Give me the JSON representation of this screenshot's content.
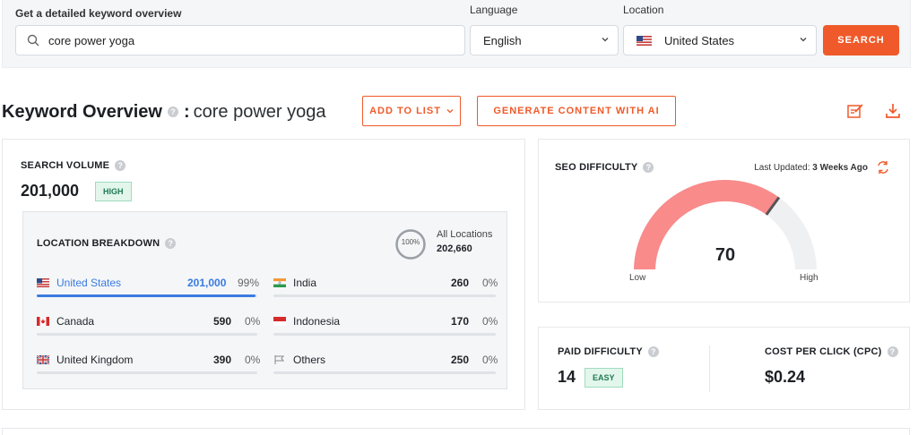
{
  "search": {
    "label": "Get a detailed keyword overview",
    "value": "core power yoga",
    "language_label": "Language",
    "language_value": "English",
    "location_label": "Location",
    "location_value": "United States",
    "button": "SEARCH"
  },
  "header": {
    "title": "Keyword Overview",
    "separator": ":",
    "keyword": "core power yoga",
    "add_to_list": "ADD TO LIST",
    "generate": "GENERATE CONTENT WITH AI"
  },
  "search_volume": {
    "title": "SEARCH VOLUME",
    "value": "201,000",
    "badge": "HIGH"
  },
  "location_breakdown": {
    "title": "LOCATION BREAKDOWN",
    "ring": "100%",
    "ring_value": 1.0,
    "all_label": "All Locations",
    "all_value": "202,660",
    "left": [
      {
        "name": "United States",
        "value": "201,000",
        "pct": "99%",
        "fill": 0.99,
        "active": true
      },
      {
        "name": "Canada",
        "value": "590",
        "pct": "0%",
        "fill": 0.0
      },
      {
        "name": "United Kingdom",
        "value": "390",
        "pct": "0%",
        "fill": 0.0
      }
    ],
    "right": [
      {
        "name": "India",
        "value": "260",
        "pct": "0%",
        "fill": 0.0
      },
      {
        "name": "Indonesia",
        "value": "170",
        "pct": "0%",
        "fill": 0.0
      },
      {
        "name": "Others",
        "value": "250",
        "pct": "0%",
        "fill": 0.0
      }
    ]
  },
  "seo_difficulty": {
    "title": "SEO DIFFICULTY",
    "updated_label": "Last Updated:",
    "updated_value": "3 Weeks Ago",
    "score": "70",
    "score_value": 70,
    "low": "Low",
    "high": "High",
    "color": "#f98b8b"
  },
  "paid_difficulty": {
    "title": "PAID DIFFICULTY",
    "value": "14",
    "badge": "EASY"
  },
  "cpc": {
    "title": "COST PER CLICK (CPC)",
    "value": "$0.24"
  },
  "colors": {
    "accent": "#f05a2a",
    "blue": "#3a7be0"
  }
}
